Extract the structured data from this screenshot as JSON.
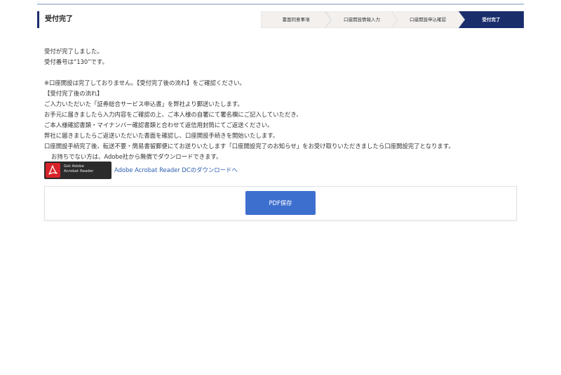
{
  "header": {
    "title": "受付完了",
    "steps": [
      {
        "label": "書面同意事項",
        "active": false
      },
      {
        "label": "口座開設情報入力",
        "active": false
      },
      {
        "label": "口座開設申込確認",
        "active": false
      },
      {
        "label": "受付完了",
        "active": true
      }
    ]
  },
  "message": {
    "lines": [
      "受付が完了しました。",
      "受付番号は“130”です。"
    ],
    "notice": "※口座開設は完了しておりません。【受付完了後の流れ】をご確認ください。",
    "flow_heading": "【受付完了後の流れ】",
    "flow_lines": [
      "ご入力いただいた「証券総合サービス申込書」を弊社より郵送いたします。",
      "お手元に届きましたら入力内容をご確認の上、ご本人様の自署にて署名欄にご記入していただき、",
      "ご本人様確認書類・マイナンバー確認書類と合わせて返信用封筒にてご返送ください。",
      "弊社に届きましたらご返送いただいた書面を確認し、口座開設手続きを開始いたします。",
      "口座開設手続完了後、転送不要・簡易書留郵便にてお送りいたします「口座開設完了のお知らせ」をお受け取りいただきましたら口座開設完了となります。"
    ],
    "adobe_note": "お持ちでない方は、Adobe社から無償でダウンロードできます。"
  },
  "adobe": {
    "badge_line1": "Get Adobe",
    "badge_line2": "Acrobat Reader",
    "link_text": "Adobe Acrobat Reader DCのダウンロードへ"
  },
  "actions": {
    "pdf_save_label": "PDF保存"
  },
  "colors": {
    "accent": "#1a2d6b",
    "step_inactive": "#f3f0ee",
    "button": "#3d6fcf",
    "link": "#2a5db0",
    "adobe_red": "#d8232a"
  }
}
